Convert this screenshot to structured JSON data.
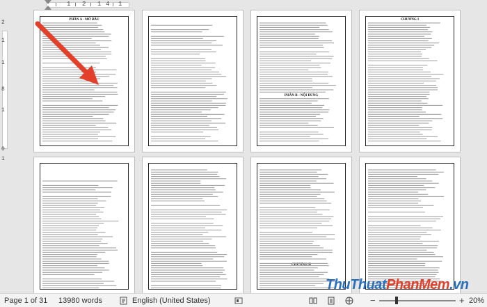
{
  "ruler": {
    "numbers": [
      "1",
      "2",
      "1",
      "4",
      "1"
    ],
    "vertical_numbers": [
      "2",
      "1",
      "1",
      "8",
      "1",
      "0",
      "1"
    ]
  },
  "pages": [
    {
      "title": "PHẦN A - MỞ ĐẦU"
    },
    {
      "title": ""
    },
    {
      "title": "PHẦN B - NỘI DUNG"
    },
    {
      "title": "CHƯƠNG I"
    },
    {
      "title": ""
    },
    {
      "title": ""
    },
    {
      "title": "CHƯƠNG II"
    },
    {
      "title": ""
    }
  ],
  "status": {
    "page": "Page 1 of 31",
    "words": "13980 words",
    "language": "English (United States)",
    "zoom_minus": "−",
    "zoom_plus": "+",
    "zoom": "20%",
    "zoom_level_percent": 20
  },
  "watermark": {
    "part1": "ThuThuat",
    "part2": "PhanMem",
    "part3": ".vn"
  },
  "colors": {
    "arrow": "#e2402a",
    "watermark_blue": "#2a6fbd",
    "watermark_red": "#e2402a"
  }
}
